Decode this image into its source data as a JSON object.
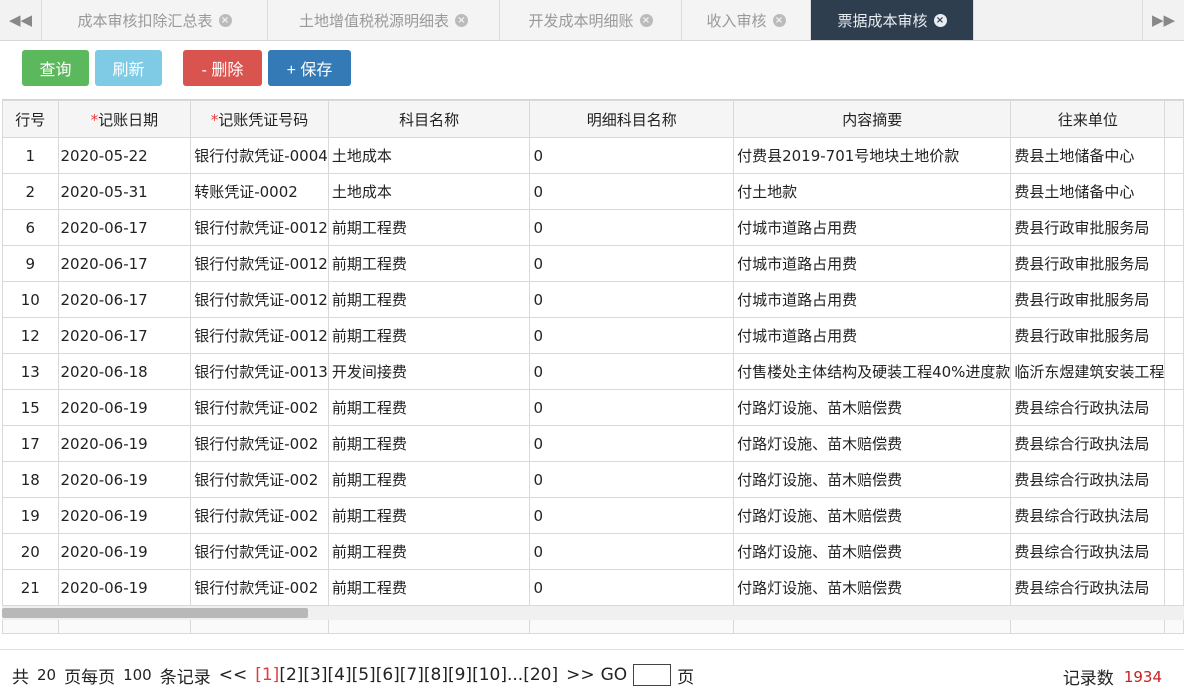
{
  "tabs": [
    {
      "label": "成本审核扣除汇总表",
      "active": false
    },
    {
      "label": "土地增值税税源明细表",
      "active": false
    },
    {
      "label": "开发成本明细账",
      "active": false
    },
    {
      "label": "收入审核",
      "active": false
    },
    {
      "label": "票据成本审核",
      "active": true
    }
  ],
  "tab_nav": {
    "prev": "◀◀",
    "next": "▶▶",
    "close": "×"
  },
  "toolbar": {
    "query": "查询",
    "refresh": "刷新",
    "delete": "- 删除",
    "save": "+ 保存"
  },
  "columns": {
    "no": "行号",
    "date_star": "*",
    "date": "记账日期",
    "voucher_star": "*",
    "voucher": "记账凭证号码",
    "subject": "科目名称",
    "detail": "明细科目名称",
    "summary": "内容摘要",
    "partner": "往来单位"
  },
  "rows": [
    {
      "no": "1",
      "date": "2020-05-22",
      "voucher": "银行付款凭证-0004",
      "subject": "土地成本",
      "detail": "0",
      "summary": "付费县2019-701号地块土地价款",
      "partner": "费县土地储备中心"
    },
    {
      "no": "2",
      "date": "2020-05-31",
      "voucher": "转账凭证-0002",
      "subject": "土地成本",
      "detail": "0",
      "summary": "付土地款",
      "partner": "费县土地储备中心"
    },
    {
      "no": "6",
      "date": "2020-06-17",
      "voucher": "银行付款凭证-0012",
      "subject": "前期工程费",
      "detail": "0",
      "summary": "付城市道路占用费",
      "partner": "费县行政审批服务局"
    },
    {
      "no": "9",
      "date": "2020-06-17",
      "voucher": "银行付款凭证-0012",
      "subject": "前期工程费",
      "detail": "0",
      "summary": "付城市道路占用费",
      "partner": "费县行政审批服务局"
    },
    {
      "no": "10",
      "date": "2020-06-17",
      "voucher": "银行付款凭证-0012",
      "subject": "前期工程费",
      "detail": "0",
      "summary": "付城市道路占用费",
      "partner": "费县行政审批服务局"
    },
    {
      "no": "12",
      "date": "2020-06-17",
      "voucher": "银行付款凭证-0012",
      "subject": "前期工程费",
      "detail": "0",
      "summary": "付城市道路占用费",
      "partner": "费县行政审批服务局"
    },
    {
      "no": "13",
      "date": "2020-06-18",
      "voucher": "银行付款凭证-0013",
      "subject": "开发间接费",
      "detail": "0",
      "summary": "付售楼处主体结构及硬装工程40%进度款",
      "partner": "临沂东煜建筑安装工程"
    },
    {
      "no": "15",
      "date": "2020-06-19",
      "voucher": "银行付款凭证-002",
      "subject": "前期工程费",
      "detail": "0",
      "summary": "付路灯设施、苗木赔偿费",
      "partner": "费县综合行政执法局"
    },
    {
      "no": "17",
      "date": "2020-06-19",
      "voucher": "银行付款凭证-002",
      "subject": "前期工程费",
      "detail": "0",
      "summary": "付路灯设施、苗木赔偿费",
      "partner": "费县综合行政执法局"
    },
    {
      "no": "18",
      "date": "2020-06-19",
      "voucher": "银行付款凭证-002",
      "subject": "前期工程费",
      "detail": "0",
      "summary": "付路灯设施、苗木赔偿费",
      "partner": "费县综合行政执法局"
    },
    {
      "no": "19",
      "date": "2020-06-19",
      "voucher": "银行付款凭证-002",
      "subject": "前期工程费",
      "detail": "0",
      "summary": "付路灯设施、苗木赔偿费",
      "partner": "费县综合行政执法局"
    },
    {
      "no": "20",
      "date": "2020-06-19",
      "voucher": "银行付款凭证-002",
      "subject": "前期工程费",
      "detail": "0",
      "summary": "付路灯设施、苗木赔偿费",
      "partner": "费县综合行政执法局"
    },
    {
      "no": "21",
      "date": "2020-06-19",
      "voucher": "银行付款凭证-002",
      "subject": "前期工程费",
      "detail": "0",
      "summary": "付路灯设施、苗木赔偿费",
      "partner": "费县综合行政执法局"
    }
  ],
  "pager": {
    "total_prefix": "共",
    "total_pages": "20",
    "page_word": "页",
    "per_page_prefix": "每页",
    "per_page": "100",
    "records_word": "条记录",
    "first": "<<",
    "pages": [
      "[1]",
      "[2]",
      "[3]",
      "[4]",
      "[5]",
      "[6]",
      "[7]",
      "[8]",
      "[9]",
      "[10]",
      "...[20]"
    ],
    "current_page": "[1]",
    "last": ">>",
    "go": "GO",
    "go_suffix": "页",
    "record_count_label": "记录数",
    "record_count": "1934"
  }
}
